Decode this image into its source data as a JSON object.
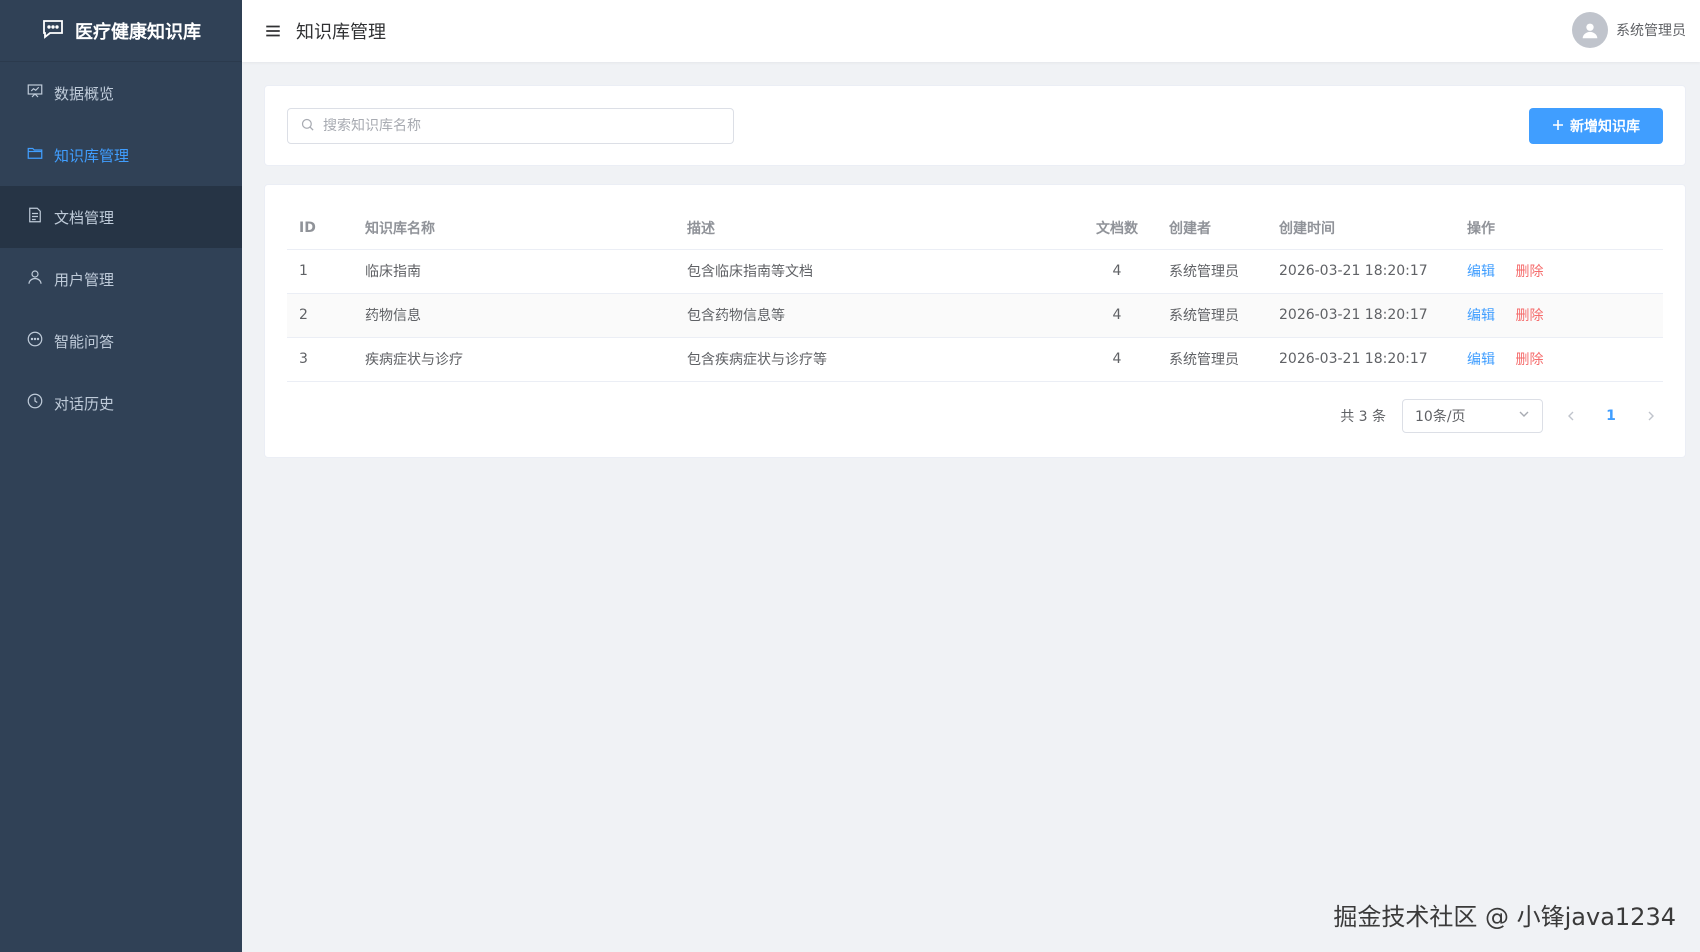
{
  "sidebar": {
    "brand": "医疗健康知识库",
    "items": [
      {
        "label": "数据概览",
        "icon": "presentation-icon"
      },
      {
        "label": "知识库管理",
        "icon": "folder-icon"
      },
      {
        "label": "文档管理",
        "icon": "document-icon"
      },
      {
        "label": "用户管理",
        "icon": "user-icon"
      },
      {
        "label": "智能问答",
        "icon": "chat-icon"
      },
      {
        "label": "对话历史",
        "icon": "clock-icon"
      }
    ]
  },
  "header": {
    "title": "知识库管理",
    "user_name": "系统管理员"
  },
  "search": {
    "placeholder": "搜索知识库名称",
    "value": ""
  },
  "toolbar": {
    "add_label": "新增知识库"
  },
  "table": {
    "columns": [
      "ID",
      "知识库名称",
      "描述",
      "文档数",
      "创建者",
      "创建时间",
      "操作"
    ],
    "rows": [
      {
        "id": "1",
        "name": "临床指南",
        "desc": "包含临床指南等文档",
        "docs": "4",
        "creator": "系统管理员",
        "created": "2026-03-21 18:20:17"
      },
      {
        "id": "2",
        "name": "药物信息",
        "desc": "包含药物信息等",
        "docs": "4",
        "creator": "系统管理员",
        "created": "2026-03-21 18:20:17"
      },
      {
        "id": "3",
        "name": "疾病症状与诊疗",
        "desc": "包含疾病症状与诊疗等",
        "docs": "4",
        "creator": "系统管理员",
        "created": "2026-03-21 18:20:17"
      }
    ],
    "edit_label": "编辑",
    "delete_label": "删除"
  },
  "pagination": {
    "total": "共 3 条",
    "page_size": "10条/页",
    "current_page": "1"
  },
  "watermark": "掘金技术社区 @ 小锋java1234",
  "colors": {
    "sidebar_bg": "#304156",
    "accent": "#409eff",
    "danger": "#f56c6c"
  }
}
